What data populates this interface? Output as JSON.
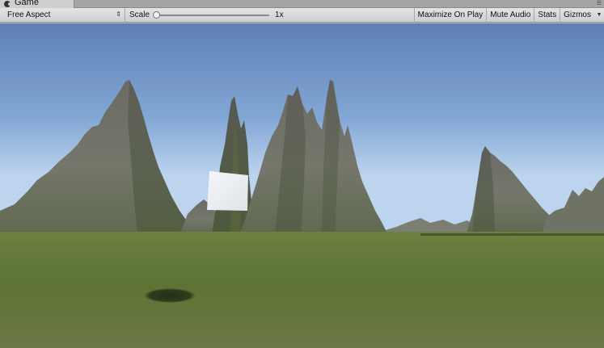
{
  "window": {
    "tab_title": "Game",
    "icon": "unity-game-icon",
    "menu_icon": "panel-menu-icon"
  },
  "toolbar": {
    "aspect_label": "Free Aspect",
    "aspect_icon": "up-down-chevron-icon",
    "scale_label": "Scale",
    "scale_value": "1x",
    "scale_level": 0,
    "maximize_label": "Maximize On Play",
    "mute_label": "Mute Audio",
    "stats_label": "Stats",
    "gizmos_label": "Gizmos",
    "gizmos_icon": "dropdown-triangle-icon"
  },
  "scene": {
    "sky_top": "#5e80b6",
    "sky_horizon": "#bcd4ee",
    "ground": "#5d7434",
    "cube": "#f4f6f8"
  }
}
